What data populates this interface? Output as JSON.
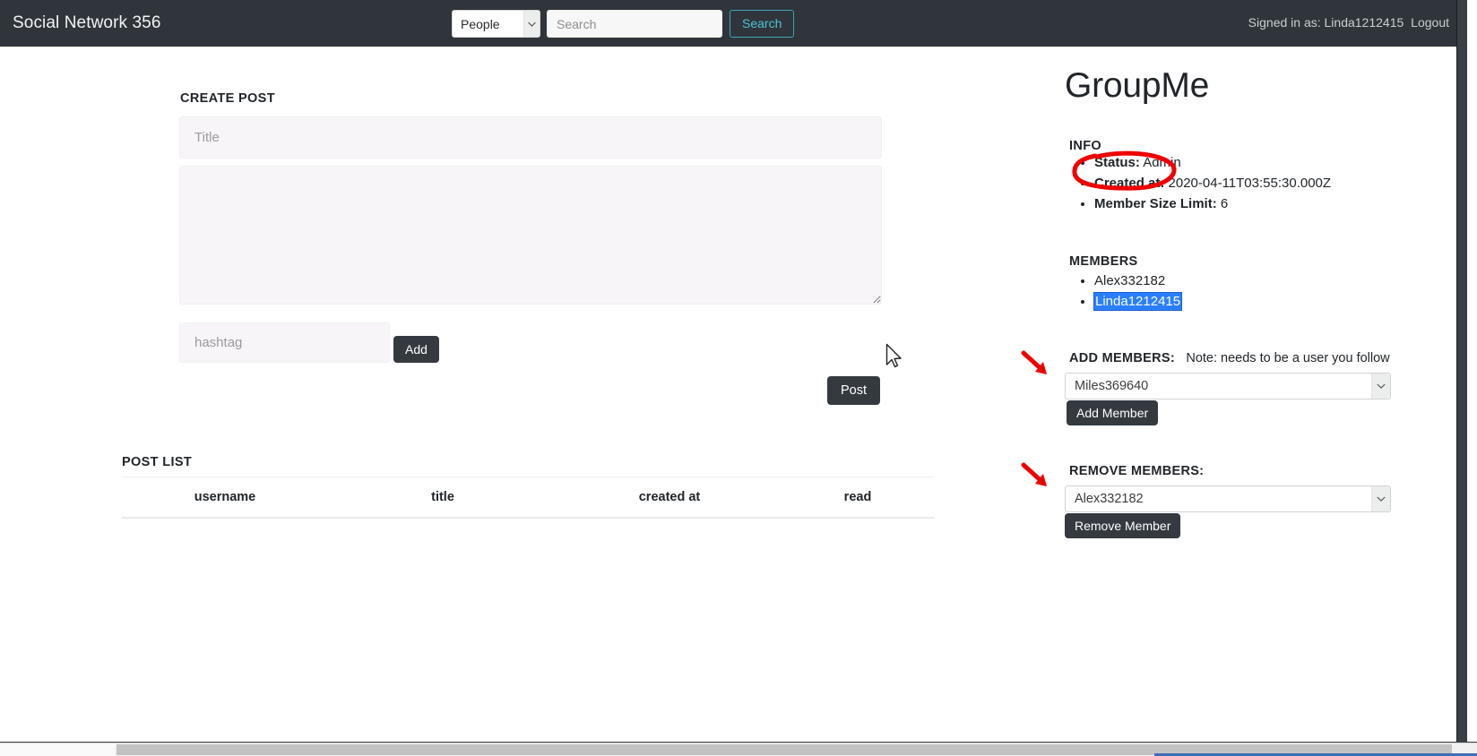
{
  "navbar": {
    "brand": "Social Network 356",
    "search_category": "People",
    "search_placeholder": "Search",
    "search_button": "Search",
    "signed_in_prefix": "Signed in as:",
    "signed_in_user": "Linda1212415",
    "logout": "Logout",
    "bg_color": "#2f353a",
    "accent_color": "#4ec3d6"
  },
  "create_post": {
    "heading": "CREATE POST",
    "title_placeholder": "Title",
    "body_placeholder": "",
    "hashtag_placeholder": "hashtag",
    "add_button": "Add",
    "post_button": "Post"
  },
  "post_list": {
    "heading": "POST LIST",
    "columns": [
      "username",
      "title",
      "created at",
      "read"
    ],
    "rows": []
  },
  "group": {
    "name": "GroupMe",
    "info_heading": "INFO",
    "info": [
      {
        "label": "Status:",
        "value": "Admin"
      },
      {
        "label": "Created at:",
        "value": "2020-04-11T03:55:30.000Z"
      },
      {
        "label": "Member Size Limit:",
        "value": "6"
      }
    ],
    "members_heading": "MEMBERS",
    "members": [
      {
        "name": "Alex332182",
        "selected": false
      },
      {
        "name": "Linda1212415",
        "selected": true
      }
    ],
    "add_members_label": "ADD MEMBERS:",
    "add_members_note": "Note: needs to be a user you follow",
    "add_member_selected": "Miles369640",
    "add_member_button": "Add Member",
    "remove_members_label": "REMOVE MEMBERS:",
    "remove_member_selected": "Alex332182",
    "remove_member_button": "Remove Member"
  },
  "annotations": {
    "ellipse_color": "#ee0000",
    "arrow_color": "#ee0000",
    "ellipse_target": "Status: Admin",
    "arrow1_target": "add-members-select",
    "arrow2_target": "remove-members-select"
  }
}
